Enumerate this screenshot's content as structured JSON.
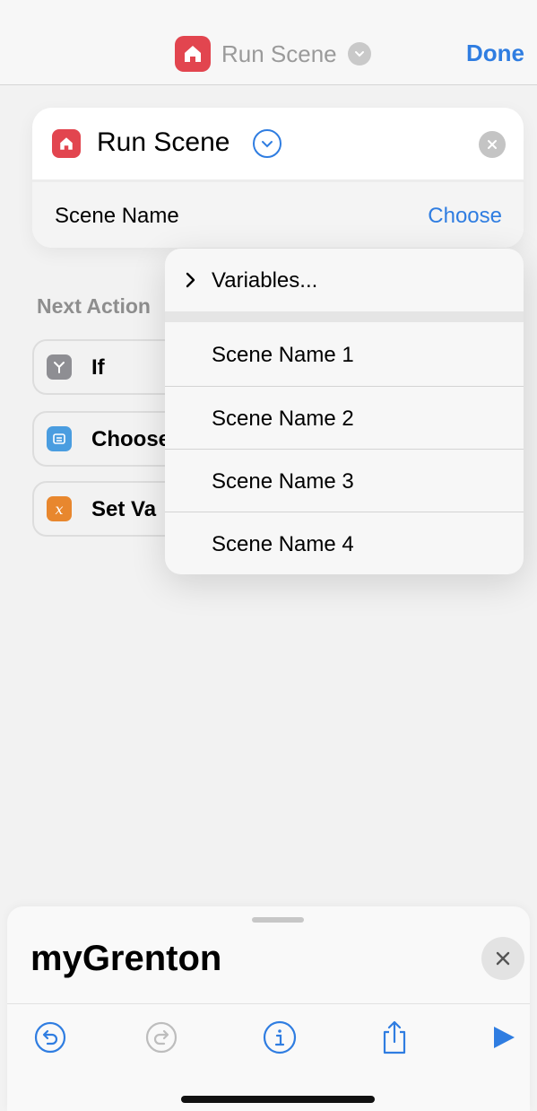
{
  "nav": {
    "title": "Run Scene",
    "done_label": "Done"
  },
  "action_card": {
    "title": "Run Scene",
    "param_label": "Scene Name",
    "choose_label": "Choose"
  },
  "next_actions": {
    "label": "Next Action",
    "items": [
      {
        "label": "If",
        "icon": "if-icon",
        "color": "#8e8e93"
      },
      {
        "label": "Choose",
        "icon": "menu-icon",
        "color": "#4a9de0"
      },
      {
        "label": "Set Va",
        "icon": "variable-icon",
        "color": "#e8872e"
      }
    ]
  },
  "menu": {
    "variables_label": "Variables...",
    "items": [
      "Scene Name 1",
      "Scene Name 2",
      "Scene Name 3",
      "Scene Name 4"
    ]
  },
  "sheet": {
    "title": "myGrenton"
  },
  "colors": {
    "accent": "#2f7de1",
    "app_icon": "#e2454f"
  }
}
